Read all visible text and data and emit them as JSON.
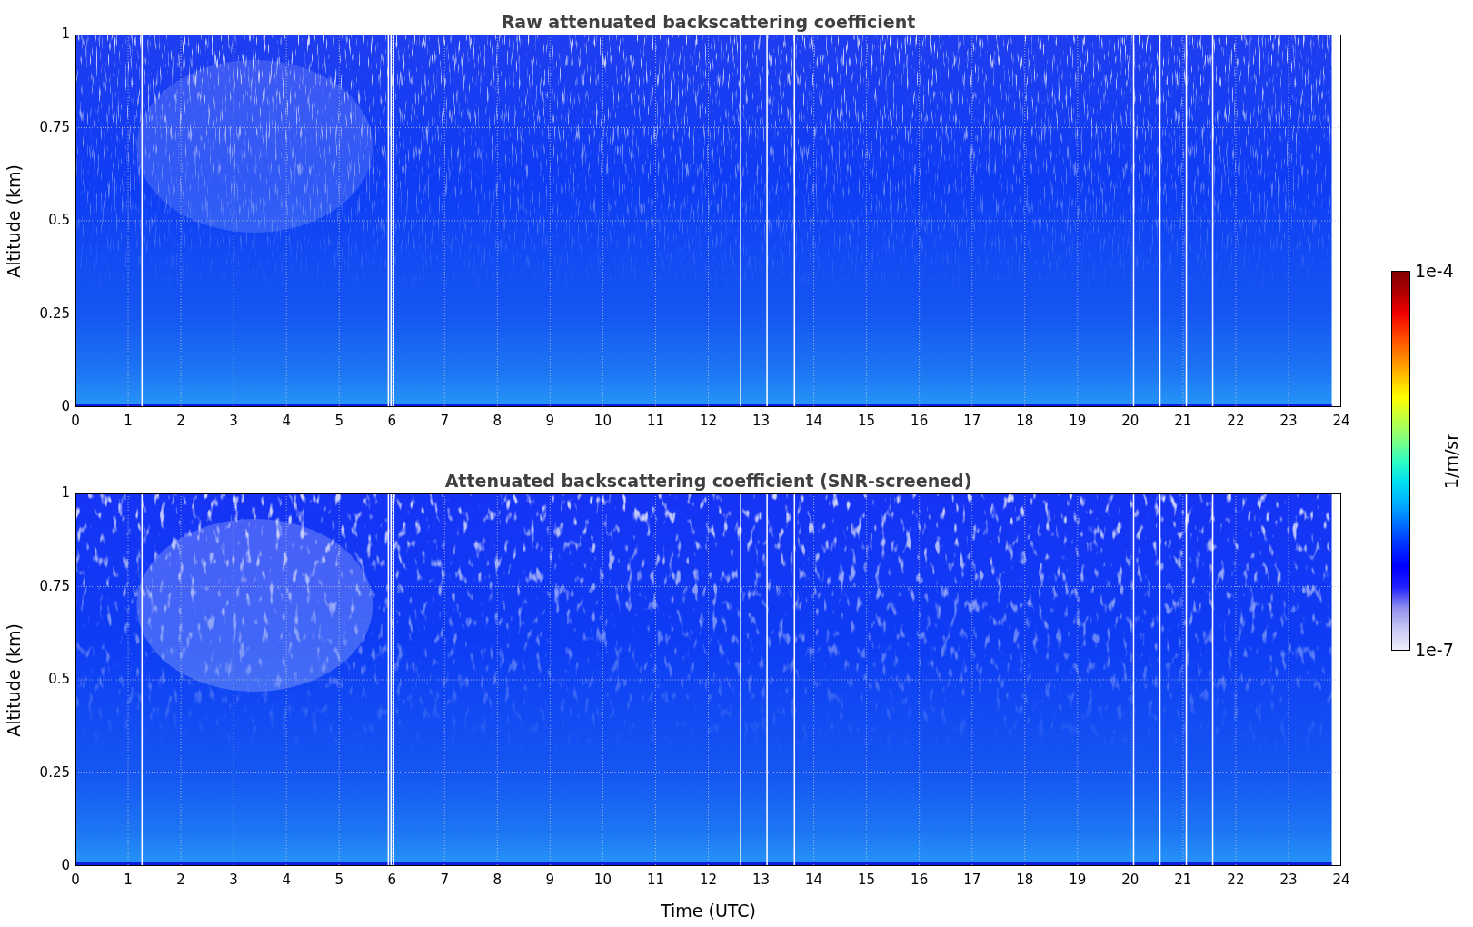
{
  "panels": [
    {
      "title": "Raw attenuated backscattering coefficient",
      "ylabel": "Altitude (km)",
      "yticks": [
        "1",
        "0.75",
        "0.5",
        "0.25",
        "0"
      ],
      "xticks": [
        "0",
        "1",
        "2",
        "3",
        "4",
        "5",
        "6",
        "7",
        "8",
        "9",
        "10",
        "11",
        "12",
        "13",
        "14",
        "15",
        "16",
        "17",
        "18",
        "19",
        "20",
        "21",
        "22",
        "23",
        "24"
      ]
    },
    {
      "title": "Attenuated backscattering coefficient (SNR-screened)",
      "ylabel": "Altitude (km)",
      "yticks": [
        "1",
        "0.75",
        "0.5",
        "0.25",
        "0"
      ],
      "xticks": [
        "0",
        "1",
        "2",
        "3",
        "4",
        "5",
        "6",
        "7",
        "8",
        "9",
        "10",
        "11",
        "12",
        "13",
        "14",
        "15",
        "16",
        "17",
        "18",
        "19",
        "20",
        "21",
        "22",
        "23",
        "24"
      ],
      "xlabel": "Time (UTC)"
    }
  ],
  "colorbar": {
    "max_label": "1e-4",
    "min_label": "1e-7",
    "label": "1/m/sr"
  }
}
